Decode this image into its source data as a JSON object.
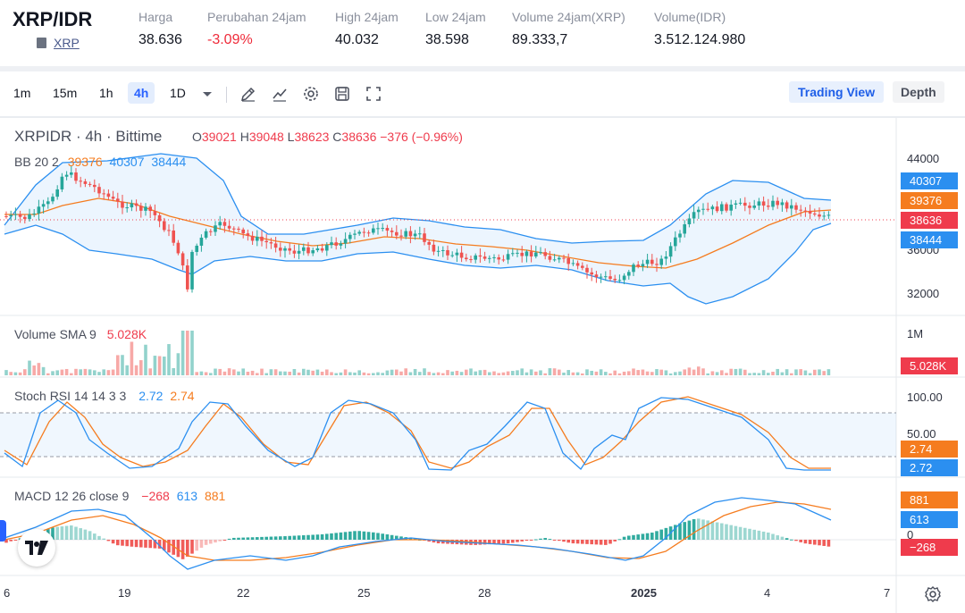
{
  "header": {
    "pair": "XRP/IDR",
    "asset_link": "XRP",
    "stats": [
      {
        "label": "Harga",
        "value": "38.636",
        "neg": false
      },
      {
        "label": "Perubahan 24jam",
        "value": "-3.09%",
        "neg": true
      },
      {
        "label": "High 24jam",
        "value": "40.032",
        "neg": false
      },
      {
        "label": "Low 24jam",
        "value": "38.598",
        "neg": false
      },
      {
        "label": "Volume 24jam(XRP)",
        "value": "89.333,7",
        "neg": false
      },
      {
        "label": "Volume(IDR)",
        "value": "3.512.124.980",
        "neg": false
      }
    ]
  },
  "toolbar": {
    "timeframes": [
      "1m",
      "15m",
      "1h",
      "4h",
      "1D"
    ],
    "active_timeframe": "4h",
    "icons": [
      "chevron-down-icon",
      "draw-tool-icon",
      "indicators-icon",
      "settings-icon",
      "save-icon",
      "fullscreen-icon"
    ],
    "trading_view_label": "Trading View",
    "depth_label": "Depth"
  },
  "chart_legend": {
    "symbol": "XRPIDR · 4h · Bittime",
    "o_label": "O",
    "o": "39021",
    "h_label": "H",
    "h": "39048",
    "l_label": "L",
    "l": "38623",
    "c_label": "C",
    "c": "38636",
    "change": "−376 (−0.96%)",
    "bb_label": "BB 20 2",
    "bb_mid": "39376",
    "bb_upper": "40307",
    "bb_lower": "38444",
    "vol_label": "Volume SMA 9",
    "vol_value": "5.028K",
    "stoch_label": "Stoch RSI 14 14 3 3",
    "stoch_k": "2.72",
    "stoch_d": "2.74",
    "macd_label": "MACD 12 26 close 9",
    "macd_hist": "−268",
    "macd_line": "613",
    "macd_signal": "881"
  },
  "price_axis": {
    "ticks": [
      "44000",
      "36000",
      "32000"
    ],
    "badges": [
      {
        "text": "40307",
        "color": "#2b8ff0"
      },
      {
        "text": "39376",
        "color": "#f57c1f"
      },
      {
        "text": "38636",
        "color": "#ef3b4c"
      },
      {
        "text": "38444",
        "color": "#2b8ff0"
      }
    ]
  },
  "volume_axis": {
    "tick": "1M",
    "badge": {
      "text": "5.028K",
      "color": "#ef3b4c"
    }
  },
  "stoch_axis": {
    "ticks": [
      "100.00",
      "50.00"
    ],
    "badges": [
      {
        "text": "2.74",
        "color": "#f57c1f"
      },
      {
        "text": "2.72",
        "color": "#2b8ff0"
      }
    ]
  },
  "macd_axis": {
    "tick": "0",
    "badges": [
      {
        "text": "881",
        "color": "#f57c1f"
      },
      {
        "text": "613",
        "color": "#2b8ff0"
      },
      {
        "text": "−268",
        "color": "#ef3b4c"
      }
    ]
  },
  "time_axis": {
    "labels": [
      "6",
      "19",
      "22",
      "25",
      "28",
      "2025",
      "4",
      "7"
    ]
  },
  "colors": {
    "up": "#26a69a",
    "down": "#ef5350",
    "bb": "#2b8ff0",
    "basis": "#f57c1f",
    "accent": "#2962ff"
  },
  "chart_data": [
    {
      "type": "candlestick",
      "title": "XRPIDR · 4h · Bittime",
      "ylim": [
        31000,
        46000
      ],
      "last_close": 38636,
      "overlays": [
        "BB 20 2"
      ]
    },
    {
      "type": "bar",
      "title": "Volume SMA 9",
      "last": "5.028K"
    },
    {
      "type": "line",
      "title": "Stoch RSI 14 14 3 3",
      "ylim": [
        0,
        100
      ],
      "k": 2.72,
      "d": 2.74
    },
    {
      "type": "line",
      "title": "MACD 12 26 close 9",
      "hist": -268,
      "macd": 613,
      "signal": 881
    }
  ]
}
